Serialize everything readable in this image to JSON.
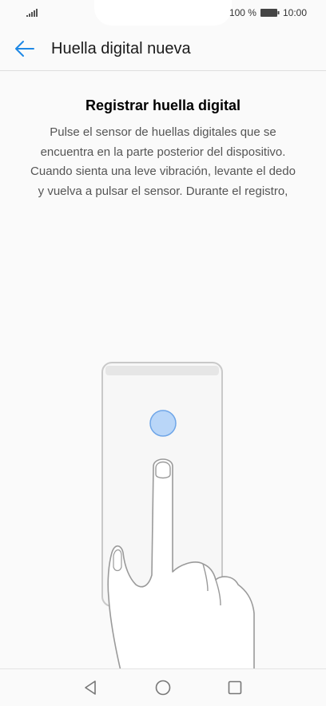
{
  "status_bar": {
    "battery_percent": "100 %",
    "time": "10:00",
    "icons": [
      "signal-icon",
      "battery-icon"
    ]
  },
  "app_bar": {
    "title": "Huella digital nueva",
    "back_icon": "arrow-left-icon",
    "accent_color": "#1e88e5"
  },
  "content": {
    "heading": "Registrar huella digital",
    "description_lines": [
      "Pulse el sensor de huellas digitales que se",
      "encuentra en la parte posterior del dispositivo.",
      "Cuando sienta una leve vibración, levante el dedo",
      "y vuelva a pulsar el sensor. Durante el registro,"
    ],
    "illustration": "finger-on-phone-sensor",
    "sensor_color": "#b9d6f8"
  },
  "nav_bar": {
    "buttons": [
      "back-triangle-icon",
      "home-circle-icon",
      "recents-square-icon"
    ]
  }
}
